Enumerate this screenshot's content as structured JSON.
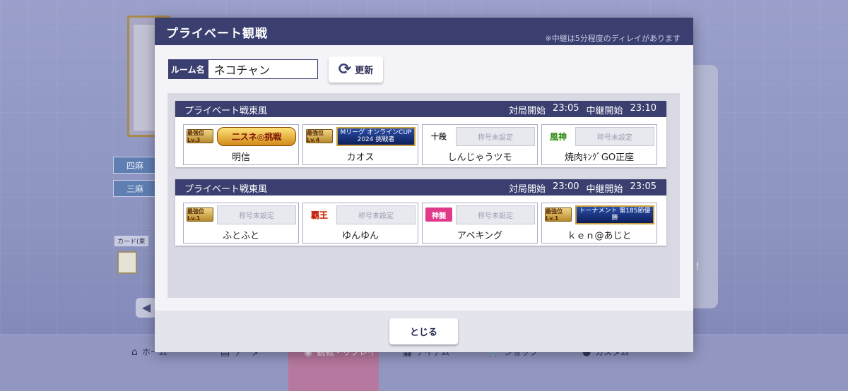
{
  "background": {
    "mode_pills": [
      "四麻",
      "三麻"
    ],
    "card_label": "カード(東",
    "nav": [
      {
        "label": "ホーム",
        "icon": "home-icon"
      },
      {
        "label": "データ",
        "icon": "data-icon"
      },
      {
        "label": "観戦・リプレイ",
        "icon": "replay-icon"
      },
      {
        "label": "アイテム",
        "icon": "item-icon"
      },
      {
        "label": "ショップ",
        "icon": "shop-icon"
      },
      {
        "label": "カスタム",
        "icon": "custom-icon"
      }
    ]
  },
  "dialog": {
    "title": "プライベート観戦",
    "note": "※中継は5分程度のディレイがあります",
    "room_label": "ルーム名",
    "room_value": "ネコチャン",
    "refresh_label": "更新",
    "close_label": "とじる"
  },
  "matches": [
    {
      "name": "プライベート戦東風",
      "start_label": "対局開始",
      "start_time": "23:05",
      "relay_label": "中継開始",
      "relay_time": "23:10",
      "players": [
        {
          "badge": "最強位Lv.3",
          "title": "二スネ◎挑戦",
          "name": "明信"
        },
        {
          "badge": "最強位Lv.4",
          "title": "Mリーグ オンラインCUP 2024 挑戦者",
          "name": "カオス"
        },
        {
          "badge": "十段",
          "title": "称号未設定",
          "name": "しんじゃうツモ"
        },
        {
          "badge": "風神",
          "title": "称号未設定",
          "name": "焼肉ｷﾝｸﾞGO正座"
        }
      ]
    },
    {
      "name": "プライベート戦東風",
      "start_label": "対局開始",
      "start_time": "23:00",
      "relay_label": "中継開始",
      "relay_time": "23:05",
      "players": [
        {
          "badge": "最強位Lv.1",
          "title": "称号未設定",
          "name": "ふとふと"
        },
        {
          "badge": "覇王",
          "title": "称号未設定",
          "name": "ゆんゆん"
        },
        {
          "badge": "神髄",
          "title": "称号未設定",
          "name": "アベキング"
        },
        {
          "badge": "最強位Lv.1",
          "title": "トーナメント 第185節優勝",
          "name": "ｋｅｎ@あじと"
        }
      ]
    }
  ]
}
